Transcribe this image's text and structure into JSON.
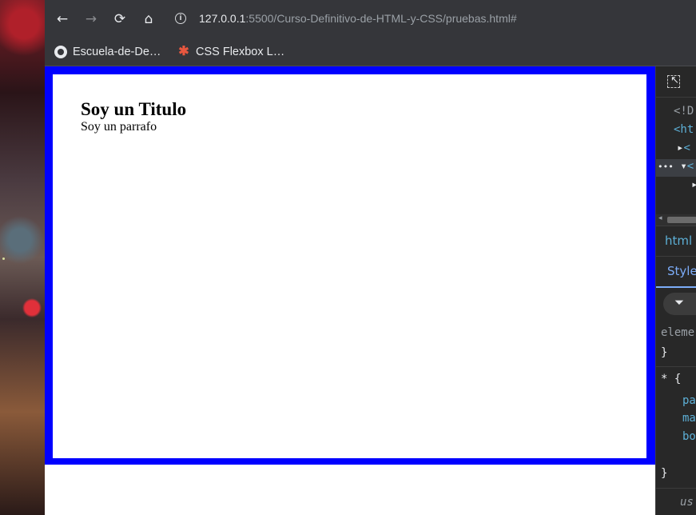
{
  "browser": {
    "nav": {
      "back_glyph": "←",
      "forward_glyph": "→",
      "reload_glyph": "⟳",
      "home_glyph": "⌂"
    },
    "omnibox": {
      "info_glyph": "i",
      "url_host": "127.0.0.1",
      "url_path": ":5500/Curso-Definitivo-de-HTML-y-CSS/pruebas.html#"
    },
    "bookmarks": [
      {
        "label": "Escuela-de-De…",
        "icon": "github-icon"
      },
      {
        "label": "CSS Flexbox L…",
        "icon": "asterisk-icon"
      }
    ]
  },
  "page": {
    "title": "Soy un Titulo",
    "paragraph": "Soy un parrafo",
    "frame_color": "#0000ff"
  },
  "devtools": {
    "elements_lines": [
      "<!D",
      "<ht",
      "<",
      "<"
    ],
    "breadcrumb": "html",
    "styles_tab": "Style",
    "element_style_label": "eleme",
    "element_style_close": "}",
    "rule_selector": "* {",
    "rule_props": [
      "pa",
      "ma",
      "bo"
    ],
    "rule_close": "}",
    "user_agent_label": "us"
  }
}
